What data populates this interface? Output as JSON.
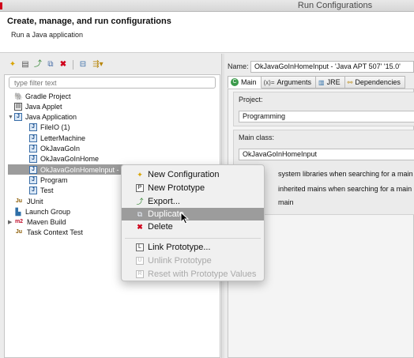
{
  "window": {
    "title": "Run Configurations"
  },
  "header": {
    "title": "Create, manage, and run configurations",
    "subtitle": "Run a Java application"
  },
  "left": {
    "toolbar": [
      {
        "name": "new-launch-config-icon",
        "glyph": "📄"
      },
      {
        "name": "new-prototype-icon",
        "glyph": "📋"
      },
      {
        "name": "export-icon",
        "glyph": "⤴"
      },
      {
        "name": "duplicate-icon",
        "glyph": "⧉"
      },
      {
        "name": "delete-icon",
        "glyph": "✖"
      },
      {
        "name": "collapse-all-icon",
        "glyph": "⊟"
      },
      {
        "name": "filter-icon",
        "glyph": "⇶▾"
      }
    ],
    "filter_placeholder": "type filter text",
    "tree": [
      {
        "label": "Gradle Project",
        "icon": "gradle-icon",
        "level": 0,
        "twisty": ""
      },
      {
        "label": "Java Applet",
        "icon": "applet-icon",
        "level": 0,
        "twisty": ""
      },
      {
        "label": "Java Application",
        "icon": "java-app-icon",
        "level": 0,
        "twisty": "▼"
      },
      {
        "label": "FileIO (1)",
        "icon": "java-app-icon",
        "level": 1,
        "twisty": ""
      },
      {
        "label": "LetterMachine",
        "icon": "java-app-icon",
        "level": 1,
        "twisty": ""
      },
      {
        "label": "OkJavaGoIn",
        "icon": "java-app-icon",
        "level": 1,
        "twisty": ""
      },
      {
        "label": "OkJavaGoInHome",
        "icon": "java-app-icon",
        "level": 1,
        "twisty": ""
      },
      {
        "label": "OkJavaGoInHomeInput -",
        "icon": "java-app-icon",
        "level": 1,
        "twisty": "",
        "selected": true
      },
      {
        "label": "Program",
        "icon": "java-app-icon",
        "level": 1,
        "twisty": ""
      },
      {
        "label": "Test",
        "icon": "java-app-icon",
        "level": 1,
        "twisty": ""
      },
      {
        "label": "JUnit",
        "icon": "junit-icon",
        "level": 0,
        "twisty": ""
      },
      {
        "label": "Launch Group",
        "icon": "launch-group-icon",
        "level": 0,
        "twisty": ""
      },
      {
        "label": "Maven Build",
        "icon": "maven-icon",
        "level": 0,
        "twisty": "▶"
      },
      {
        "label": "Task Context Test",
        "icon": "junit-icon",
        "level": 0,
        "twisty": ""
      }
    ]
  },
  "right": {
    "name_label": "Name:",
    "name_value": "OkJavaGoInHomeInput - 'Java APT 507' '15.0'",
    "tabs": [
      {
        "label": "Main",
        "glyph": "C",
        "active": true
      },
      {
        "label": "Arguments",
        "glyph": "(x)="
      },
      {
        "label": "JRE",
        "glyph": "📚"
      },
      {
        "label": "Dependencies",
        "glyph": "🔗"
      }
    ],
    "project_label": "Project:",
    "project_value": "Programming",
    "main_class_label": "Main class:",
    "main_class_value": "OkJavaGoInHomeInput",
    "options": [
      "system libraries when searching for a main",
      "inherited mains when searching for a main",
      "main"
    ]
  },
  "context_menu": {
    "items": [
      {
        "label": "New Configuration",
        "icon": "new-config-icon",
        "glyph": "📄",
        "enabled": true
      },
      {
        "label": "New Prototype",
        "icon": "new-prototype-icon",
        "glyph": "P",
        "enabled": true
      },
      {
        "label": "Export...",
        "icon": "export-icon",
        "glyph": "⤴",
        "enabled": true
      },
      {
        "label": "Duplicate",
        "icon": "duplicate-icon",
        "glyph": "⧉",
        "enabled": true,
        "highlighted": true
      },
      {
        "label": "Delete",
        "icon": "delete-icon",
        "glyph": "✖",
        "enabled": true
      },
      {
        "label": "Link Prototype...",
        "icon": "link-prototype-icon",
        "glyph": "L",
        "enabled": true
      },
      {
        "label": "Unlink Prototype",
        "icon": "unlink-prototype-icon",
        "glyph": "U",
        "enabled": false
      },
      {
        "label": "Reset with Prototype Values",
        "icon": "reset-prototype-icon",
        "glyph": "R",
        "enabled": false
      }
    ]
  },
  "colors": {
    "selection": "#9c9c9c",
    "disabled_text": "#a9a9a9",
    "delete_red": "#d0021b"
  }
}
